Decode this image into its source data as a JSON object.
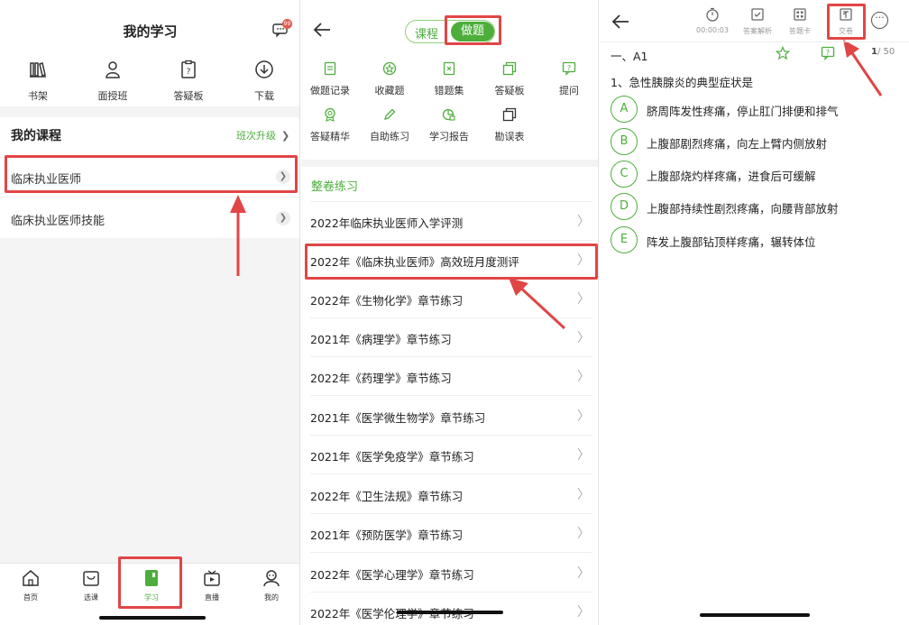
{
  "panel1": {
    "title": "我的学习",
    "badge": "99",
    "icons": [
      {
        "label": "书架",
        "icon": "bookshelf-icon"
      },
      {
        "label": "面授班",
        "icon": "teacher-icon"
      },
      {
        "label": "答疑板",
        "icon": "qa-board-icon"
      },
      {
        "label": "下载",
        "icon": "download-icon"
      }
    ],
    "section_title": "我的课程",
    "section_link": "班次升级",
    "courses": [
      "临床执业医师",
      "临床执业医师技能"
    ],
    "tabs": [
      {
        "label": "首页",
        "icon": "home-icon"
      },
      {
        "label": "选课",
        "icon": "cart-icon"
      },
      {
        "label": "学习",
        "icon": "study-icon"
      },
      {
        "label": "直播",
        "icon": "tv-icon"
      },
      {
        "label": "我的",
        "icon": "profile-icon"
      }
    ],
    "active_tab": "学习"
  },
  "panel2": {
    "seg_course": "课程",
    "seg_exercise": "做题",
    "grid": [
      {
        "label": "做题记录",
        "icon": "record-icon"
      },
      {
        "label": "收藏题",
        "icon": "star-icon"
      },
      {
        "label": "错题集",
        "icon": "wrong-set-icon"
      },
      {
        "label": "答疑板",
        "icon": "qa-board-icon"
      },
      {
        "label": "提问",
        "icon": "question-icon"
      },
      {
        "label": "答疑精华",
        "icon": "medal-icon"
      },
      {
        "label": "自助练习",
        "icon": "pencil-icon"
      },
      {
        "label": "学习报告",
        "icon": "report-icon"
      },
      {
        "label": "勘误表",
        "icon": "errata-icon"
      }
    ],
    "section_title": "整卷练习",
    "papers": [
      "2022年临床执业医师入学评测",
      "2022年《临床执业医师》高效班月度测评",
      "2022年《生物化学》章节练习",
      "2021年《病理学》章节练习",
      "2022年《药理学》章节练习",
      "2021年《医学微生物学》章节练习",
      "2021年《医学免疫学》章节练习",
      "2022年《卫生法规》章节练习",
      "2021年《预防医学》章节练习",
      "2022年《医学心理学》章节练习",
      "2022年《医学伦理学》章节练习"
    ]
  },
  "panel3": {
    "tools": [
      {
        "label": "00:00:03",
        "icon": "timer-icon"
      },
      {
        "label": "答案解析",
        "icon": "answer-icon"
      },
      {
        "label": "答题卡",
        "icon": "answer-card-icon"
      },
      {
        "label": "交卷",
        "icon": "submit-icon"
      }
    ],
    "section": "一、A1",
    "page_current": "1",
    "page_total": "/ 50",
    "question": "1、急性胰腺炎的典型症状是",
    "options": [
      {
        "key": "A",
        "text": "脐周阵发性疼痛，停止肛门排便和排气"
      },
      {
        "key": "B",
        "text": "上腹部剧烈疼痛，向左上臂内侧放射"
      },
      {
        "key": "C",
        "text": "上腹部烧灼样疼痛，进食后可缓解"
      },
      {
        "key": "D",
        "text": "上腹部持续性剧烈疼痛，向腰背部放射"
      },
      {
        "key": "E",
        "text": "阵发上腹部钻顶样疼痛，辗转体位"
      }
    ]
  },
  "colors": {
    "accent": "#4dae3c",
    "highlight": "#e04646"
  }
}
